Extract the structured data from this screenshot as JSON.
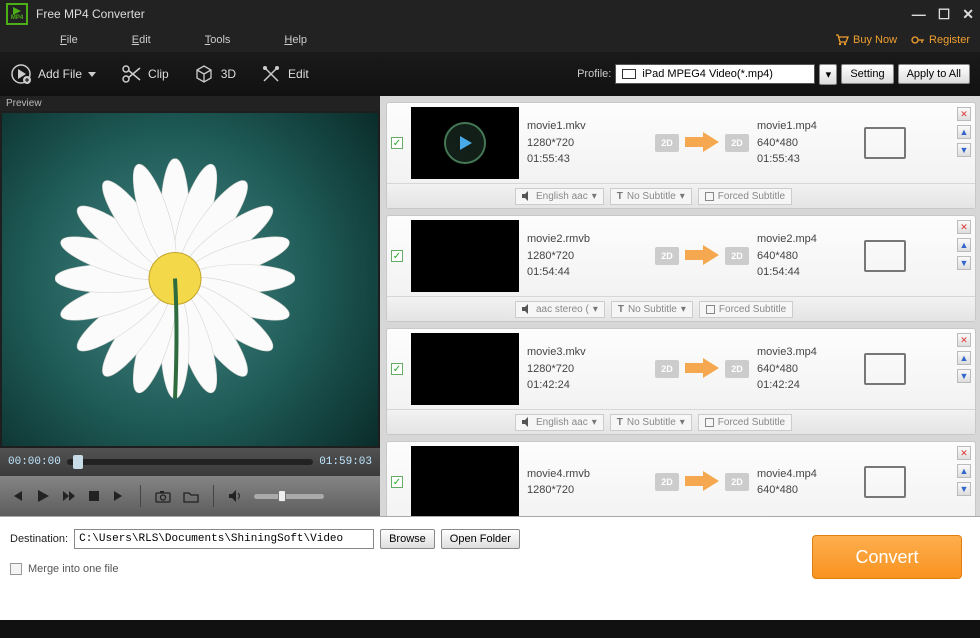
{
  "app": {
    "title": "Free MP4 Converter",
    "logo_text": "MP4"
  },
  "menubar": {
    "items": [
      "File",
      "Edit",
      "Tools",
      "Help"
    ],
    "buy_now": "Buy Now",
    "register": "Register"
  },
  "toolbar": {
    "add_file": "Add File",
    "clip": "Clip",
    "three_d": "3D",
    "edit": "Edit",
    "profile_label": "Profile:",
    "profile_value": "iPad MPEG4 Video(*.mp4)",
    "setting": "Setting",
    "apply_all": "Apply to All"
  },
  "preview": {
    "label": "Preview",
    "time_current": "00:00:00",
    "time_total": "01:59:03"
  },
  "items": [
    {
      "checked": true,
      "has_play_overlay": true,
      "src_name": "movie1.mkv",
      "src_res": "1280*720",
      "src_dur": "01:55:43",
      "out_name": "movie1.mp4",
      "out_res": "640*480",
      "out_dur": "01:55:43",
      "badge_in": "2D",
      "badge_out": "2D",
      "audio": "English aac",
      "subtitle": "No Subtitle",
      "forced": "Forced Subtitle"
    },
    {
      "checked": true,
      "has_play_overlay": false,
      "src_name": "movie2.rmvb",
      "src_res": "1280*720",
      "src_dur": "01:54:44",
      "out_name": "movie2.mp4",
      "out_res": "640*480",
      "out_dur": "01:54:44",
      "badge_in": "2D",
      "badge_out": "2D",
      "audio": "aac stereo (",
      "subtitle": "No Subtitle",
      "forced": "Forced Subtitle"
    },
    {
      "checked": true,
      "has_play_overlay": false,
      "src_name": "movie3.mkv",
      "src_res": "1280*720",
      "src_dur": "01:42:24",
      "out_name": "movie3.mp4",
      "out_res": "640*480",
      "out_dur": "01:42:24",
      "badge_in": "2D",
      "badge_out": "2D",
      "audio": "English aac",
      "subtitle": "No Subtitle",
      "forced": "Forced Subtitle"
    },
    {
      "checked": true,
      "has_play_overlay": false,
      "src_name": "movie4.rmvb",
      "src_res": "1280*720",
      "src_dur": "",
      "out_name": "movie4.mp4",
      "out_res": "640*480",
      "out_dur": "",
      "badge_in": "2D",
      "badge_out": "2D",
      "audio": "",
      "subtitle": "",
      "forced": ""
    }
  ],
  "bottom": {
    "destination_label": "Destination:",
    "destination_value": "C:\\Users\\RLS\\Documents\\ShiningSoft\\Video",
    "browse": "Browse",
    "open_folder": "Open Folder",
    "merge": "Merge into one file",
    "convert": "Convert"
  }
}
